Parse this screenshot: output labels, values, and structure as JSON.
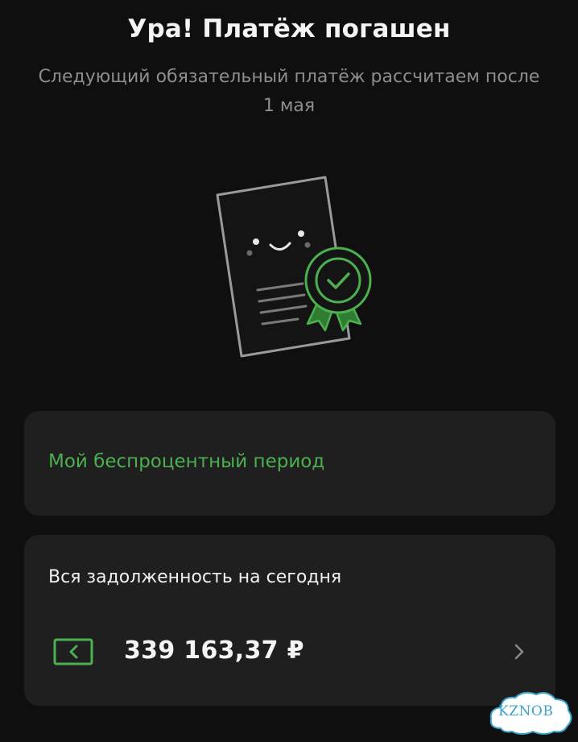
{
  "header": {
    "title": "Ура! Платёж погашен",
    "subtitle": "Следующий обязательный платёж рассчитаем после 1 мая"
  },
  "illustration": {
    "icon": "document-with-badge-icon",
    "accent_color": "#4caf50"
  },
  "period_card": {
    "label": "Мой беспроцентный период",
    "label_color": "#4caf50"
  },
  "debt_card": {
    "label": "Вся задолженность на сегодня",
    "amount": "339 163,37 ₽",
    "card_icon": "credit-card-icon",
    "chevron_icon": "chevron-right-icon"
  },
  "watermark": {
    "text": "KZNOB"
  },
  "colors": {
    "background": "#0f0f0f",
    "card_background": "#1f1f1f",
    "accent": "#4caf50",
    "muted_text": "#8e8e8e"
  }
}
